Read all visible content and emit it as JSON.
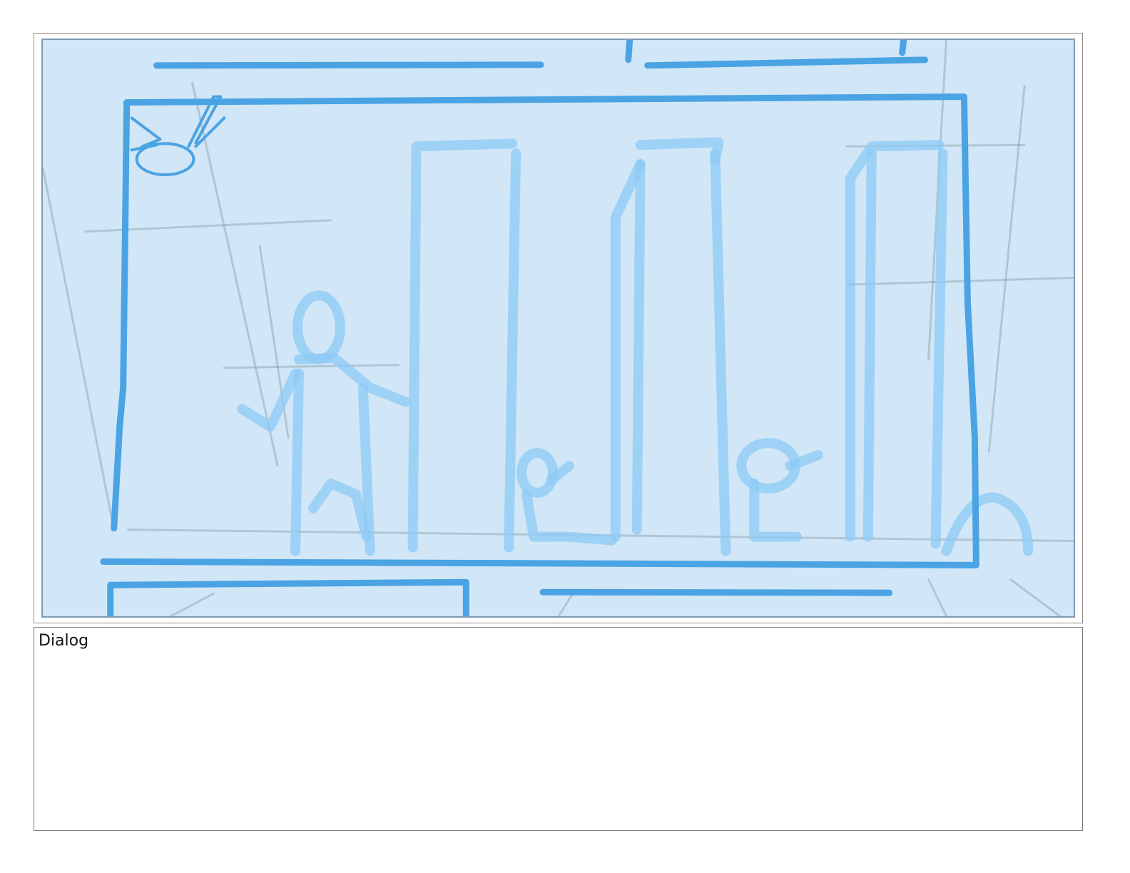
{
  "panel": {
    "sketch_stroke_color": "#4aa3e3",
    "faint_stroke_color": "#8ccaf5",
    "guide_line_color": "#6f8a96",
    "background_color": "#d1e6f6"
  },
  "dialog": {
    "label": "Dialog",
    "text": ""
  }
}
